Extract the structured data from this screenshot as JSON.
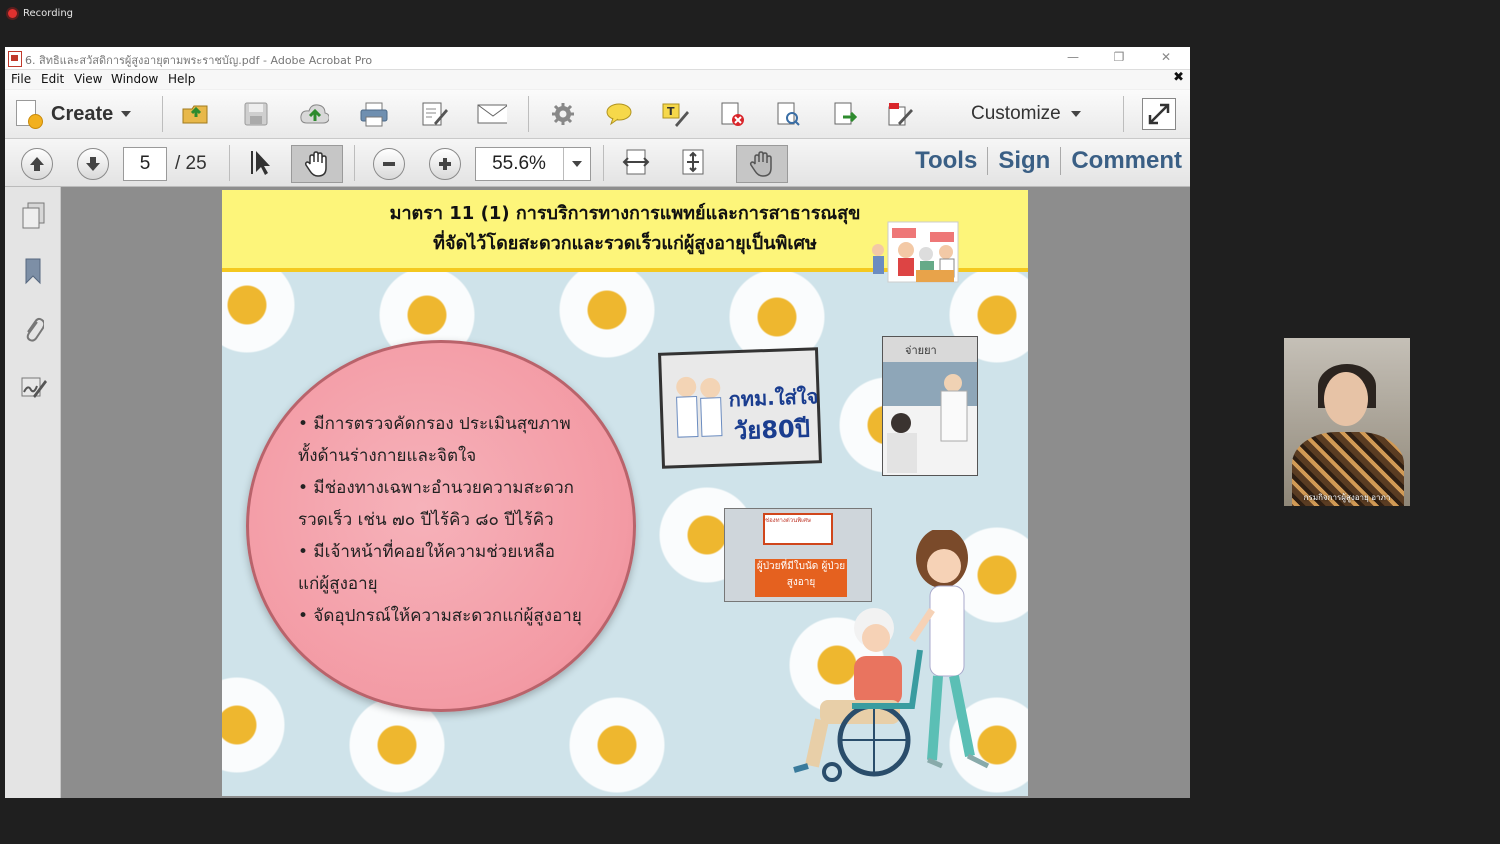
{
  "recording": {
    "label": "Recording"
  },
  "window": {
    "title": "6. สิทธิและสวัสดิการผู้สูงอายุตามพระราชบัญ.pdf - Adobe Acrobat Pro",
    "controls": {
      "minimize": "—",
      "restore": "❐",
      "close": "✕"
    }
  },
  "menubar": {
    "items": [
      "File",
      "Edit",
      "View",
      "Window",
      "Help"
    ],
    "close_doc": "✖"
  },
  "toolbar": {
    "create_label": "Create",
    "customize_label": "Customize",
    "icons": [
      "open-icon",
      "save-icon",
      "cloud-upload-icon",
      "print-icon",
      "edit-icon",
      "email-icon",
      "settings-icon",
      "comment-icon",
      "highlight-icon",
      "delete-page-icon",
      "search-page-icon",
      "export-icon",
      "sign-icon",
      "expand-icon"
    ]
  },
  "nav": {
    "current_page": "5",
    "total_pages": "/  25",
    "zoom": "55.6%",
    "links": {
      "tools": "Tools",
      "sign": "Sign",
      "comment": "Comment"
    }
  },
  "slide": {
    "title_line1": "มาตรา 11 (1) การบริการทางการแพทย์และการสาธารณสุข",
    "title_line2": "ที่จัดไว้โดยสะดวกและรวดเร็วแก่ผู้สูงอายุเป็นพิเศษ",
    "bullets": [
      "• มีการตรวจคัดกรอง ประเมินสุขภาพ",
      "ทั้งด้านร่างกายและจิตใจ",
      "• มีช่องทางเฉพาะอำนวยความสะดวก",
      "รวดเร็ว เช่น ๗๐ ปีไร้คิว ๘๐ ปีไร้คิว",
      "• มีเจ้าหน้าที่คอยให้ความช่วยเหลือ",
      "แก่ผู้สูงอายุ",
      "• จัดอุปกรณ์ให้ความสะดวกแก่ผู้สูงอายุ"
    ],
    "photo1": {
      "line1": "กทม.ใส่ใจ",
      "line2": "วัย80ปี"
    },
    "photo2": {
      "sign": "จ่ายยา"
    },
    "photo3": {
      "sign_top": "ช่องทางด่วนพิเศษ",
      "sign_bottom": "ผู้ป่วยที่มีใบนัด ผู้ป่วยสูงอายุ"
    }
  },
  "video": {
    "name": "กรมกิจการผู้สูงอายุ อาภา"
  },
  "colors": {
    "header_yellow": "#fdf57a",
    "circle_pink": "#f39aa4",
    "link_blue": "#3a5f85",
    "rec_red": "#e0312f"
  }
}
